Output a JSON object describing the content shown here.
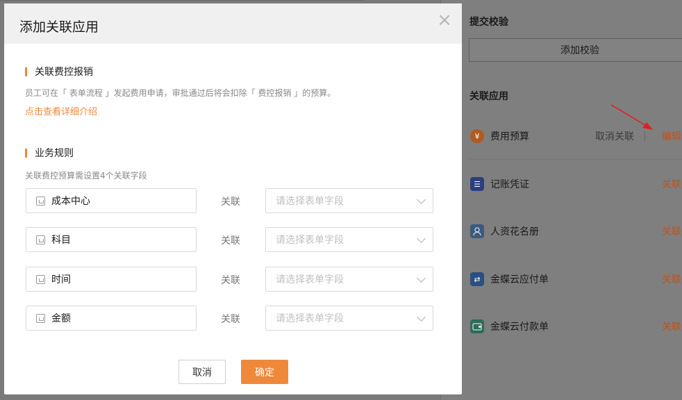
{
  "modal": {
    "title": "添加关联应用",
    "close_glyph": "×",
    "section1": {
      "title": "关联费控报销",
      "description": "员工可在「 表单流程 」发起费用申请，审批通过后将会扣除「 费控报销 」的预算。",
      "link": "点击查看详细介绍"
    },
    "section2": {
      "title": "业务规则",
      "description": "关联费控预算需设置4个关联字段"
    },
    "fields": [
      {
        "name": "成本中心",
        "link_label": "关联",
        "placeholder": "请选择表单字段"
      },
      {
        "name": "科目",
        "link_label": "关联",
        "placeholder": "请选择表单字段"
      },
      {
        "name": "时间",
        "link_label": "关联",
        "placeholder": "请选择表单字段"
      },
      {
        "name": "金额",
        "link_label": "关联",
        "placeholder": "请选择表单字段"
      }
    ],
    "cancel_label": "取消",
    "ok_label": "确定",
    "accent_color": "#f0883a"
  },
  "right_panel": {
    "submit_title": "提交校验",
    "add_check_label": "添加校验",
    "related_title": "关联应用",
    "apps": [
      {
        "name": "费用预算",
        "icon": "yen-icon",
        "icon_glyph": "¥",
        "icon_color": "#b05a20",
        "action": "编辑",
        "secondary_action": "取消关联"
      },
      {
        "name": "记账凭证",
        "icon": "voucher-icon",
        "icon_glyph": "☰",
        "icon_color": "#2b3f80",
        "action": "关联"
      },
      {
        "name": "人资花名册",
        "icon": "person-icon",
        "icon_glyph": "👤",
        "icon_color": "#3c5a80",
        "action": "关联"
      },
      {
        "name": "金蝶云应付单",
        "icon": "transfer-icon",
        "icon_glyph": "⇄",
        "icon_color": "#2b4f80",
        "action": "关联"
      },
      {
        "name": "金蝶云付款单",
        "icon": "wallet-icon",
        "icon_glyph": "▬",
        "icon_color": "#2f6b5a",
        "action": "关联"
      }
    ]
  }
}
